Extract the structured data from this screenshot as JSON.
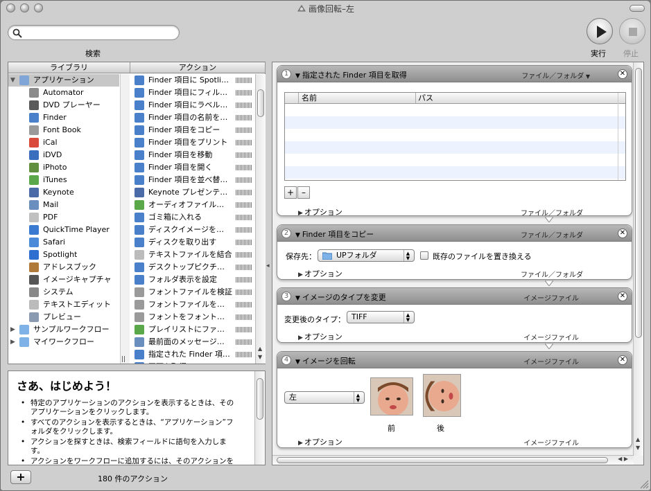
{
  "window": {
    "title": "画像回転–左"
  },
  "toolbar": {
    "search_placeholder": "",
    "search_label": "検索",
    "run_label": "実行",
    "stop_label": "停止"
  },
  "library": {
    "column_title": "ライブラリ",
    "items": [
      {
        "label": "アプリケーション",
        "icon": "applications-folder-icon",
        "expanded": true,
        "selected": true,
        "indent": 0
      },
      {
        "label": "Automator",
        "icon": "automator-icon",
        "indent": 1
      },
      {
        "label": "DVD プレーヤー",
        "icon": "dvd-player-icon",
        "indent": 1
      },
      {
        "label": "Finder",
        "icon": "finder-icon",
        "indent": 1
      },
      {
        "label": "Font Book",
        "icon": "font-book-icon",
        "indent": 1
      },
      {
        "label": "iCal",
        "icon": "ical-icon",
        "indent": 1
      },
      {
        "label": "iDVD",
        "icon": "idvd-icon",
        "indent": 1
      },
      {
        "label": "iPhoto",
        "icon": "iphoto-icon",
        "indent": 1
      },
      {
        "label": "iTunes",
        "icon": "itunes-icon",
        "indent": 1
      },
      {
        "label": "Keynote",
        "icon": "keynote-icon",
        "indent": 1
      },
      {
        "label": "Mail",
        "icon": "mail-icon",
        "indent": 1
      },
      {
        "label": "PDF",
        "icon": "pdf-icon",
        "indent": 1
      },
      {
        "label": "QuickTime Player",
        "icon": "quicktime-icon",
        "indent": 1
      },
      {
        "label": "Safari",
        "icon": "safari-icon",
        "indent": 1
      },
      {
        "label": "Spotlight",
        "icon": "spotlight-icon",
        "indent": 1
      },
      {
        "label": "アドレスブック",
        "icon": "address-book-icon",
        "indent": 1
      },
      {
        "label": "イメージキャプチャ",
        "icon": "image-capture-icon",
        "indent": 1
      },
      {
        "label": "システム",
        "icon": "system-icon",
        "indent": 1
      },
      {
        "label": "テキストエディット",
        "icon": "textedit-icon",
        "indent": 1
      },
      {
        "label": "プレビュー",
        "icon": "preview-icon",
        "indent": 1
      },
      {
        "label": "サンプルワークフロー",
        "icon": "folder-icon",
        "expanded": false,
        "indent": 0
      },
      {
        "label": "マイワークフロー",
        "icon": "folder-icon",
        "expanded": false,
        "indent": 0
      }
    ]
  },
  "actions": {
    "column_title": "アクション",
    "items": [
      {
        "label": "Finder 項目に Spotli…",
        "icon": "finder-icon"
      },
      {
        "label": "Finder 項目にフィル…",
        "icon": "finder-icon"
      },
      {
        "label": "Finder 項目にラベル…",
        "icon": "finder-icon"
      },
      {
        "label": "Finder 項目の名前を変更",
        "icon": "finder-icon"
      },
      {
        "label": "Finder 項目をコピー",
        "icon": "finder-icon"
      },
      {
        "label": "Finder 項目をプリント",
        "icon": "finder-icon"
      },
      {
        "label": "Finder 項目を移動",
        "icon": "finder-icon"
      },
      {
        "label": "Finder 項目を開く",
        "icon": "finder-icon"
      },
      {
        "label": "Finder 項目を並べ替える",
        "icon": "finder-icon"
      },
      {
        "label": "Keynote プレゼンテ…",
        "icon": "keynote-icon"
      },
      {
        "label": "オーディオファイル…",
        "icon": "itunes-icon"
      },
      {
        "label": "ゴミ箱に入れる",
        "icon": "finder-icon"
      },
      {
        "label": "ディスクイメージを…",
        "icon": "finder-icon"
      },
      {
        "label": "ディスクを取り出す",
        "icon": "finder-icon"
      },
      {
        "label": "テキストファイルを結合",
        "icon": "textedit-icon"
      },
      {
        "label": "デスクトップピクチ…",
        "icon": "finder-icon"
      },
      {
        "label": "フォルダ表示を設定",
        "icon": "finder-icon"
      },
      {
        "label": "フォントファイルを検証",
        "icon": "font-book-icon"
      },
      {
        "label": "フォントファイルを…",
        "icon": "font-book-icon"
      },
      {
        "label": "フォントをフォント…",
        "icon": "font-book-icon"
      },
      {
        "label": "プレイリストにファ…",
        "icon": "itunes-icon"
      },
      {
        "label": "最前面のメッセージ…",
        "icon": "mail-icon"
      },
      {
        "label": "指定された Finder 項…",
        "icon": "finder-icon"
      },
      {
        "label": "画面を取得",
        "icon": "finder-icon"
      }
    ]
  },
  "description": {
    "title": "さあ、はじめよう！",
    "bullets": [
      "特定のアプリケーションのアクションを表示するときは、そのアプリケーションをクリックします。",
      "すべてのアクションを表示するときは、“アプリケーション”フォルダをクリックします。",
      "アクションを探すときは、検索フィールドに語句を入力します。",
      "アクションをワークフローに追加するには、そのアクションをワークフロー領域にドラッグします。"
    ]
  },
  "status": {
    "count_text": "180 件のアクション",
    "add_label": "+"
  },
  "workflow": {
    "actions": [
      {
        "number": "1",
        "title": "指定された Finder 項目を取得",
        "type_label": "ファイル／フォルダ",
        "options_label": "オプション",
        "output_label": "ファイル／フォルダ",
        "table_columns": [
          "名前",
          "パス"
        ],
        "add_label": "+",
        "remove_label": "–"
      },
      {
        "number": "2",
        "title": "Finder 項目をコピー",
        "type_label": "ファイル／フォルダ",
        "dest_label": "保存先：",
        "dest_value": "UPフォルダ",
        "replace_label": "既存のファイルを置き換える",
        "replace_checked": false,
        "options_label": "オプション",
        "output_label": "ファイル／フォルダ"
      },
      {
        "number": "3",
        "title": "イメージのタイプを変更",
        "type_label": "イメージファイル",
        "format_label": "変更後のタイプ：",
        "format_value": "TIFF",
        "options_label": "オプション",
        "output_label": "イメージファイル"
      },
      {
        "number": "4",
        "title": "イメージを回転",
        "type_label": "イメージファイル",
        "direction_value": "左",
        "before_label": "前",
        "after_label": "後",
        "options_label": "オプション",
        "output_label": "イメージファイル"
      }
    ]
  },
  "colors": {
    "selected_row": "#c7c7c7",
    "stripe": "#edf3fe",
    "action_header": "#9e9e9e"
  }
}
